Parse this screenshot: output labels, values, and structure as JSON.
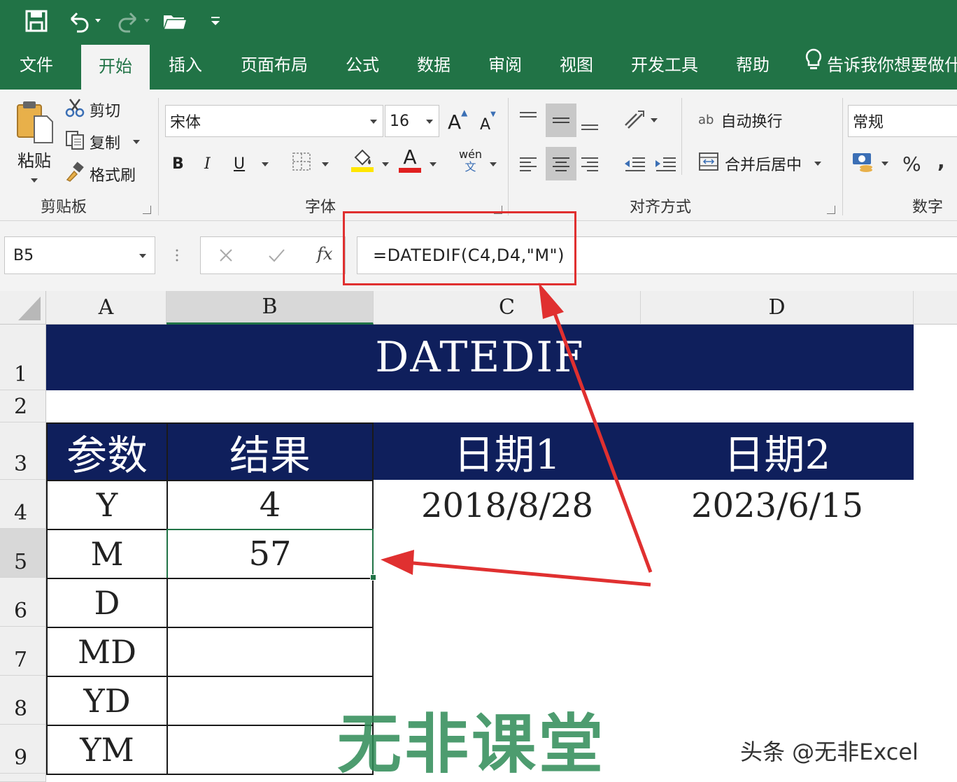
{
  "qat": {
    "save_icon": "save-icon",
    "undo_icon": "undo-icon",
    "redo_icon": "redo-icon",
    "open_icon": "folder-open-icon",
    "customize_icon": "customize-qat-icon"
  },
  "tabs": [
    {
      "label": "文件"
    },
    {
      "label": "开始"
    },
    {
      "label": "插入"
    },
    {
      "label": "页面布局"
    },
    {
      "label": "公式"
    },
    {
      "label": "数据"
    },
    {
      "label": "审阅"
    },
    {
      "label": "视图"
    },
    {
      "label": "开发工具"
    },
    {
      "label": "帮助"
    }
  ],
  "tellme": {
    "label": "告诉我你想要做什"
  },
  "clipboard": {
    "paste_label": "粘贴",
    "cut_label": "剪切",
    "copy_label": "复制",
    "format_painter_label": "格式刷",
    "group_label": "剪贴板"
  },
  "font": {
    "name": "宋体",
    "size": "16",
    "grow_label": "A",
    "shrink_label": "A",
    "bold_label": "B",
    "italic_label": "I",
    "underline_label": "U",
    "font_color_label": "A",
    "phonetic_top": "wén",
    "phonetic_bottom": "文",
    "group_label": "字体",
    "highlight_color": "#ffe600",
    "font_color": "#e02020"
  },
  "alignment": {
    "wrap_label": "自动换行",
    "merge_label": "合并后居中",
    "wrap_icon_text": "ab",
    "group_label": "对齐方式"
  },
  "number": {
    "format": "常规",
    "percent_label": "%",
    "comma_label": ",",
    "group_label": "数字"
  },
  "formula_bar": {
    "name_box": "B5",
    "fx_label": "fx",
    "formula": "=DATEDIF(C4,D4,\"M\")"
  },
  "columns": [
    "A",
    "B",
    "C",
    "D"
  ],
  "rows": [
    "1",
    "2",
    "3",
    "4",
    "5",
    "6",
    "7",
    "8",
    "9"
  ],
  "sheet": {
    "title": "DATEDIF",
    "header_param": "参数",
    "header_result": "结果",
    "header_date1": "日期1",
    "header_date2": "日期2",
    "params": [
      "Y",
      "M",
      "D",
      "MD",
      "YD",
      "YM"
    ],
    "results": [
      "4",
      "57",
      "",
      "",
      "",
      ""
    ],
    "date1": "2018/8/28",
    "date2": "2023/6/15",
    "navy": "#0f1f5c"
  },
  "watermark": "无非课堂",
  "credit": "头条 @无非Excel",
  "colors": {
    "excel_green": "#217346",
    "arrow_red": "#e03030"
  }
}
